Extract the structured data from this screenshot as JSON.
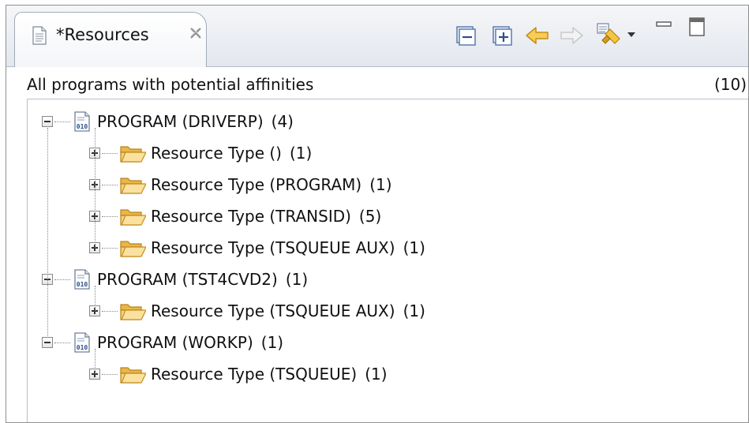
{
  "view": {
    "tab_title": "*Resources",
    "toolbar": {
      "collapse_all_icon": "collapse-all-icon",
      "expand_all_icon": "expand-all-icon",
      "back_icon": "back-arrow-icon",
      "forward_icon": "forward-arrow-icon",
      "filter_icon": "filter-icon"
    },
    "colors": {
      "folder": "#f2c35a",
      "back_arrow": "#f0b21d",
      "tab_border": "#a3acb8"
    }
  },
  "header": {
    "label": "All programs with potential affinities",
    "count": "(10)"
  },
  "tree": {
    "programs": [
      {
        "label": "PROGRAM (DRIVERP)",
        "count": "(4)",
        "children": [
          {
            "label": "Resource Type ()",
            "count": "(1)"
          },
          {
            "label": "Resource Type (PROGRAM)",
            "count": "(1)"
          },
          {
            "label": "Resource Type (TRANSID)",
            "count": "(5)"
          },
          {
            "label": "Resource Type (TSQUEUE AUX)",
            "count": "(1)"
          }
        ]
      },
      {
        "label": "PROGRAM (TST4CVD2)",
        "count": "(1)",
        "children": [
          {
            "label": "Resource Type (TSQUEUE AUX)",
            "count": "(1)"
          }
        ]
      },
      {
        "label": "PROGRAM (WORKP)",
        "count": "(1)",
        "children": [
          {
            "label": "Resource Type (TSQUEUE)",
            "count": "(1)"
          }
        ]
      }
    ]
  }
}
